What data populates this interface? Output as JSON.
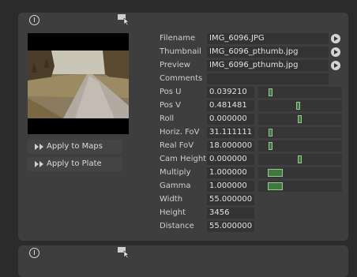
{
  "actions": {
    "apply_to_maps": "Apply to Maps",
    "apply_to_plate": "Apply to Plate"
  },
  "files": [
    {
      "label": "Filename",
      "value": "IMG_6096.JPG"
    },
    {
      "label": "Thumbnail",
      "value": "IMG_6096_pthumb.jpg"
    },
    {
      "label": "Preview",
      "value": "IMG_6096_pthumb.jpg"
    },
    {
      "label": "Comments",
      "value": ""
    }
  ],
  "params": [
    {
      "label": "Pos U",
      "value": "0.039210",
      "slider": 0.04
    },
    {
      "label": "Pos V",
      "value": "0.481481",
      "slider": 0.48
    },
    {
      "label": "Roll",
      "value": "0.000000",
      "slider": 0.5
    },
    {
      "label": "Horiz. FoV",
      "value": "31.111111",
      "slider": 0.1
    },
    {
      "label": "Real FoV",
      "value": "18.000000",
      "slider": 0.1
    },
    {
      "label": "Cam Height",
      "value": "0.000000",
      "slider": 0.5
    },
    {
      "label": "Multiply",
      "value": "1.000000",
      "slider": 0.2
    },
    {
      "label": "Gamma",
      "value": "1.000000",
      "slider": 0.2
    },
    {
      "label": "Width",
      "value": "55.000000"
    },
    {
      "label": "Height",
      "value": "3456"
    },
    {
      "label": "Distance",
      "value": "55.000000"
    }
  ],
  "colors": {
    "panel": "#3e3e3e",
    "slider_fill": "#3e7a3c"
  },
  "icons": [
    "info-icon",
    "pointer-icon",
    "play-icon",
    "double-arrow-icon"
  ]
}
